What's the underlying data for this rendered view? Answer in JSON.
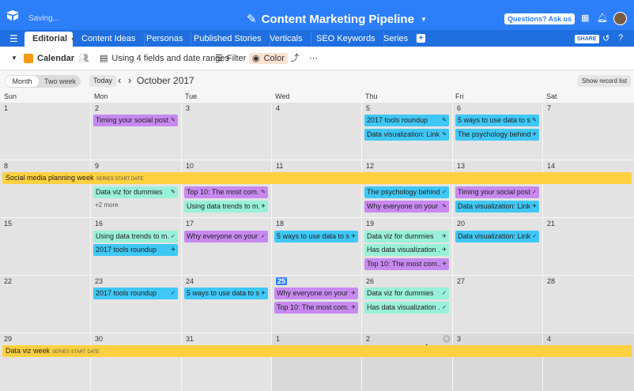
{
  "app": {
    "status": "Saving...",
    "base_title": "Content Marketing Pipeline",
    "help_button": "Questions? Ask us",
    "share_button": "SHARE"
  },
  "tabs": [
    {
      "label": "Editorial",
      "active": true
    },
    {
      "label": "Content Ideas",
      "active": false
    },
    {
      "label": "Personas",
      "active": false
    },
    {
      "label": "Published Stories",
      "active": false
    },
    {
      "label": "Verticals",
      "active": false
    },
    {
      "label": "SEO Keywords",
      "active": false
    },
    {
      "label": "Series",
      "active": false
    }
  ],
  "toolbar": {
    "view_name": "Calendar",
    "fields_label": "Using 4 fields and date ranges",
    "filter_label": "Filter",
    "color_label": "Color"
  },
  "calendar": {
    "mode_month": "Month",
    "mode_two_week": "Two week",
    "today_button": "Today",
    "month_label": "October 2017",
    "show_records_button": "Show record list",
    "day_names": [
      "Sun",
      "Mon",
      "Tue",
      "Wed",
      "Thu",
      "Fri",
      "Sat"
    ],
    "weeks": [
      {
        "days": [
          "1",
          "2",
          "3",
          "4",
          "5",
          "6",
          "7"
        ],
        "other": [
          false,
          false,
          false,
          false,
          false,
          false,
          false
        ]
      },
      {
        "days": [
          "8",
          "9",
          "10",
          "11",
          "12",
          "13",
          "14"
        ],
        "other": [
          false,
          false,
          false,
          false,
          false,
          false,
          false
        ]
      },
      {
        "days": [
          "15",
          "16",
          "17",
          "18",
          "19",
          "20",
          "21"
        ],
        "other": [
          false,
          false,
          false,
          false,
          false,
          false,
          false
        ]
      },
      {
        "days": [
          "22",
          "23",
          "24",
          "25",
          "26",
          "27",
          "28"
        ],
        "other": [
          false,
          false,
          false,
          false,
          false,
          false,
          false
        ]
      },
      {
        "days": [
          "29",
          "30",
          "31",
          "1",
          "2",
          "3",
          "4"
        ],
        "other": [
          false,
          false,
          false,
          true,
          true,
          true,
          true
        ]
      }
    ],
    "today_date": "25",
    "more_label": "+2 more",
    "banners": [
      {
        "title": "Social media planning week",
        "sub": "SERIES START DATE"
      },
      {
        "title": "Data viz week",
        "sub": "SERIES START DATE"
      }
    ],
    "events": [
      {
        "title": "Timing your social post...",
        "status": "✎",
        "color": "purple"
      },
      {
        "title": "2017 tools roundup",
        "status": "✎",
        "color": "blue"
      },
      {
        "title": "Data visualization: Link...",
        "status": "✎",
        "color": "blue"
      },
      {
        "title": "5 ways to use data to s...",
        "status": "✎",
        "color": "blue"
      },
      {
        "title": "The psychology behind...",
        "status": "✈",
        "color": "blue"
      },
      {
        "title": "Data viz for dummies",
        "status": "✎",
        "color": "teal"
      },
      {
        "title": "Top 10: The most com...",
        "status": "✎",
        "color": "purple"
      },
      {
        "title": "Using data trends to m...",
        "status": "✈",
        "color": "teal"
      },
      {
        "title": "The psychology behind...",
        "status": "✓",
        "color": "blue"
      },
      {
        "title": "Why everyone on your ...",
        "status": "✎",
        "color": "purple"
      },
      {
        "title": "Timing your social post...",
        "status": "✓",
        "color": "purple"
      },
      {
        "title": "Data visualization: Link...",
        "status": "✈",
        "color": "blue"
      },
      {
        "title": "Using data trends to m...",
        "status": "✓",
        "color": "teal"
      },
      {
        "title": "2017 tools roundup",
        "status": "✈",
        "color": "blue"
      },
      {
        "title": "Why everyone on your ...",
        "status": "✓",
        "color": "purple"
      },
      {
        "title": "5 ways to use data to s...",
        "status": "✈",
        "color": "blue"
      },
      {
        "title": "Data viz for dummies",
        "status": "✈",
        "color": "teal"
      },
      {
        "title": "Has data visualization ...",
        "status": "✈",
        "color": "teal"
      },
      {
        "title": "Top 10: The most com...",
        "status": "✈",
        "color": "purple"
      },
      {
        "title": "Data visualization: Link...",
        "status": "✓",
        "color": "blue"
      },
      {
        "title": "2017 tools roundup",
        "status": "✓",
        "color": "blue"
      },
      {
        "title": "5 ways to use data to s...",
        "status": "✈",
        "color": "blue"
      },
      {
        "title": "Why everyone on your ...",
        "status": "✈",
        "color": "purple"
      },
      {
        "title": "Top 10: The most com...",
        "status": "✈",
        "color": "purple"
      },
      {
        "title": "Data viz for dummies",
        "status": "✓",
        "color": "teal"
      },
      {
        "title": "Has data visualization ...",
        "status": "✓",
        "color": "teal"
      }
    ]
  },
  "colors": {
    "brand_blue": "#2d7ff9",
    "banner_yellow": "#ffd140",
    "event_purple": "#c789f0",
    "event_blue": "#3fc7f5",
    "event_teal": "#99f0d8"
  },
  "icons": [
    "logo-icon",
    "pencil-icon",
    "grid-icon",
    "bell-icon",
    "menu-icon",
    "history-icon",
    "calendar-icon",
    "share-users-icon",
    "fields-icon",
    "filter-icon",
    "color-icon",
    "expand-icon",
    "more-icon"
  ]
}
